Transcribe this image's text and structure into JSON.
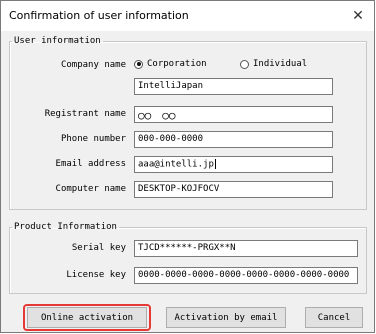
{
  "window": {
    "title": "Confirmation of user information",
    "close_glyph": "✕"
  },
  "user_info": {
    "legend": "User information",
    "company_name_label": "Company name",
    "corporation_label": "Corporation",
    "individual_label": "Individual",
    "company_name_value": "IntelliJapan",
    "registrant_name_label": "Registrant name",
    "registrant_name_value": "○○　○○",
    "phone_label": "Phone number",
    "phone_value": "000-000-0000",
    "email_label": "Email address",
    "email_value": "aaa@intelli.jp",
    "computer_label": "Computer name",
    "computer_value": "DESKTOP-KOJFOCV"
  },
  "product_info": {
    "legend": "Product Information",
    "serial_label": "Serial key",
    "serial_value": "TJCD******-PRGX**N",
    "license_label": "License key",
    "license_value": "0000-0000-0000-0000-0000-0000-0000-0000"
  },
  "buttons": {
    "online_activation": "Online activation",
    "activation_by_email": "Activation by email",
    "cancel": "Cancel"
  },
  "colors": {
    "highlight": "#e53935"
  }
}
